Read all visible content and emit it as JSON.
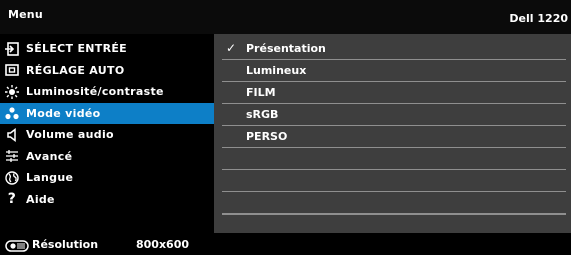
{
  "titlebar": {
    "title": "Menu",
    "model": "Dell 1220"
  },
  "menu": {
    "items": [
      {
        "label": "SÉLECT ENTRÉE",
        "icon": "input-select-icon"
      },
      {
        "label": "RÉGLAGE AUTO",
        "icon": "auto-adjust-icon"
      },
      {
        "label": "Luminosité/contraste",
        "icon": "brightness-icon"
      },
      {
        "label": "Mode vidéo",
        "icon": "video-mode-icon",
        "selected": true
      },
      {
        "label": "Volume audio",
        "icon": "speaker-icon"
      },
      {
        "label": "Avancé",
        "icon": "advanced-settings-icon"
      },
      {
        "label": "Langue",
        "icon": "globe-icon"
      },
      {
        "label": "Aide",
        "icon": "help-icon"
      }
    ]
  },
  "submenu": {
    "checked_mark": "✓",
    "options": [
      "Présentation",
      "Lumineux",
      "FILM",
      "sRGB",
      "PERSO",
      "",
      "",
      "",
      ""
    ],
    "selected_index": 0
  },
  "status": {
    "icon": "resolution-icon",
    "label": "Résolution",
    "value": "800x600"
  },
  "colors": {
    "selected_bg": "#0d7fc7",
    "submenu_bg": "#3e3e3e",
    "background": "#000000"
  }
}
